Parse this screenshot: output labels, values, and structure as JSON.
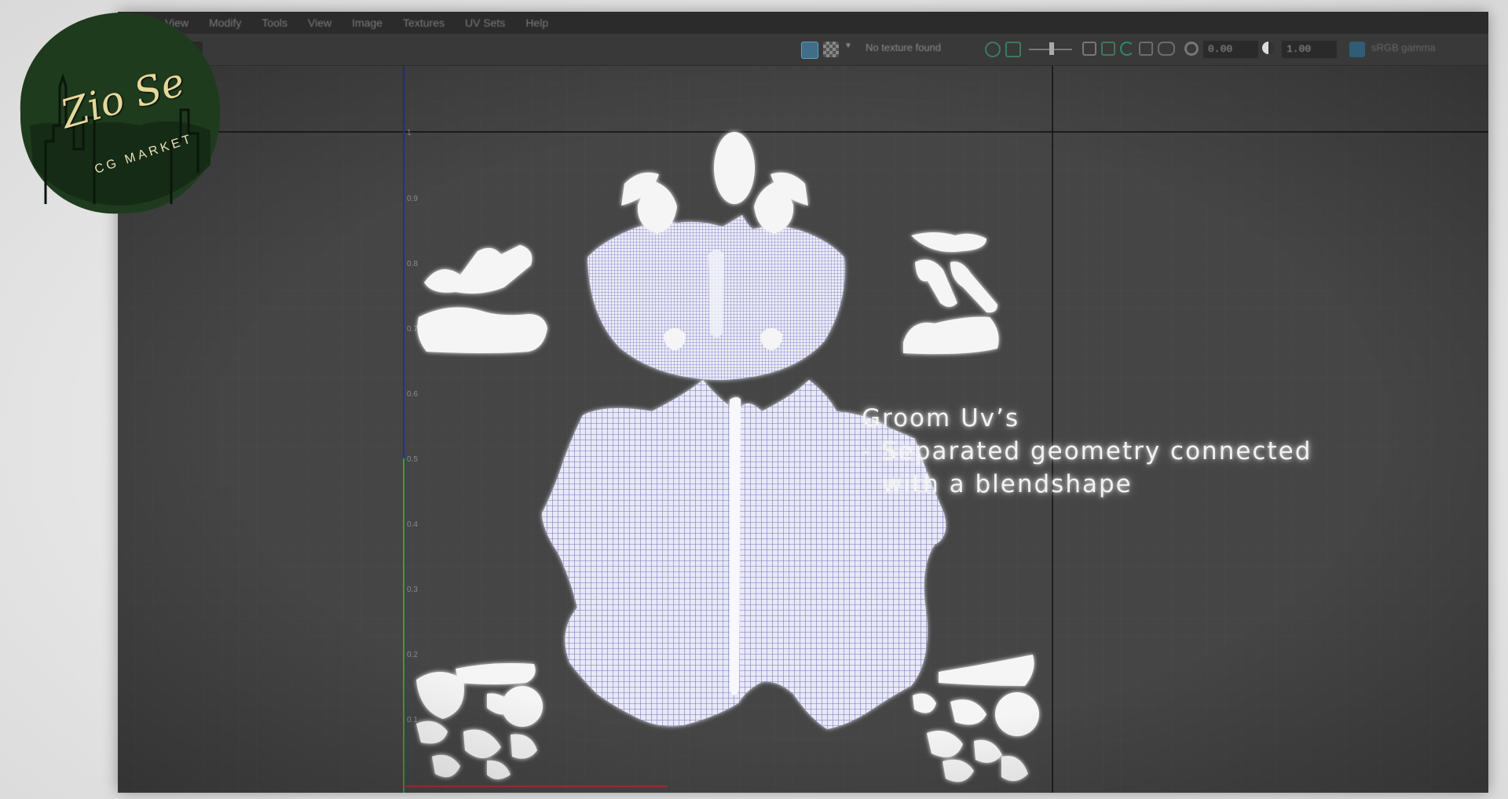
{
  "menubar": {
    "items": [
      "View",
      "Modify",
      "Tools",
      "View",
      "Image",
      "Textures",
      "UV Sets",
      "Help"
    ]
  },
  "toolbar": {
    "texture_status": "No texture found",
    "exposure_value": "0.00",
    "gamma_value": "1.00",
    "colorspace_label": "sRGB gamma"
  },
  "axis": {
    "v_ticks": [
      "1",
      "0.9",
      "0.8",
      "0.7",
      "0.6",
      "0.5",
      "0.4",
      "0.3",
      "0.2",
      "0.1"
    ]
  },
  "overlay": {
    "line1": "Groom Uv’s",
    "line2": "- Separated geometry connected",
    "line3": "with a blendshape"
  },
  "logo": {
    "title": "Zio Se",
    "subtitle": "CG MARKET"
  },
  "colors": {
    "grid_bg": "#444444",
    "uv_wire": "#7f82c4",
    "uv_fill": "#d8d9f0",
    "shell_white": "#f5f5f5",
    "v_axis": "#2a2aa8",
    "u_axis_green": "#2ea043",
    "logo_green": "#1f3b1e",
    "logo_text": "#e6d89a"
  }
}
